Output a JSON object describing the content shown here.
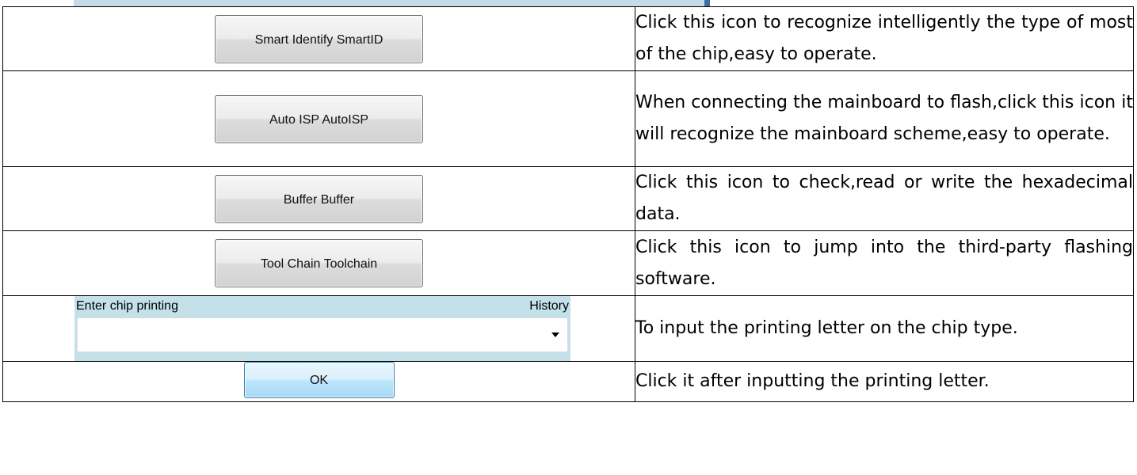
{
  "rows": [
    {
      "button_label": "Smart Identify SmartID",
      "description": "Click this icon to recognize intelligently the type of most of the chip,easy to operate."
    },
    {
      "button_label": "Auto ISP AutoISP",
      "description": "When connecting the mainboard to flash,click this icon it will recognize the mainboard scheme,easy to operate."
    },
    {
      "button_label": "Buffer Buffer",
      "description": "Click this icon to check,read or write the hexadecimal data."
    },
    {
      "button_label": "Tool Chain Toolchain",
      "description": "Click this icon to jump into the third-party flashing software."
    }
  ],
  "chip_input": {
    "label": "Enter chip printing",
    "history_label": "History",
    "value": "",
    "description": "To input the printing letter on the chip type."
  },
  "ok_row": {
    "button_label": "OK",
    "description": "Click it after inputting the printing letter."
  }
}
